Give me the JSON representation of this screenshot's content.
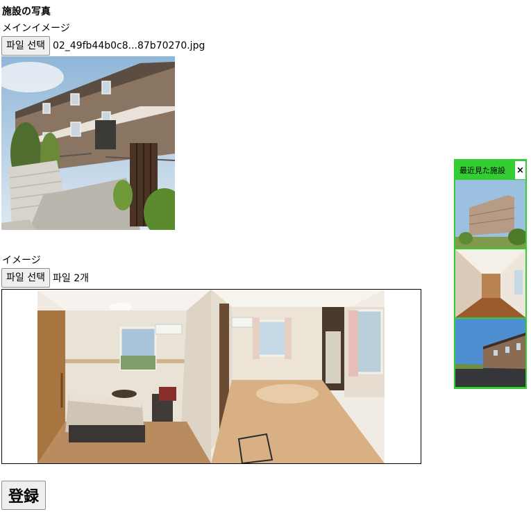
{
  "section_title": "施設の写真",
  "main_image": {
    "label": "メインイメージ",
    "button_label": "파일 선택",
    "file_name": "02_49fb44b0c8...87b70270.jpg"
  },
  "images": {
    "label": "イメージ",
    "button_label": "파일 선택",
    "file_status": "파일 2개"
  },
  "submit_label": "登録",
  "recent_panel": {
    "title": "最近見た施設",
    "close_label": "×",
    "accent_color": "#33cc33"
  }
}
